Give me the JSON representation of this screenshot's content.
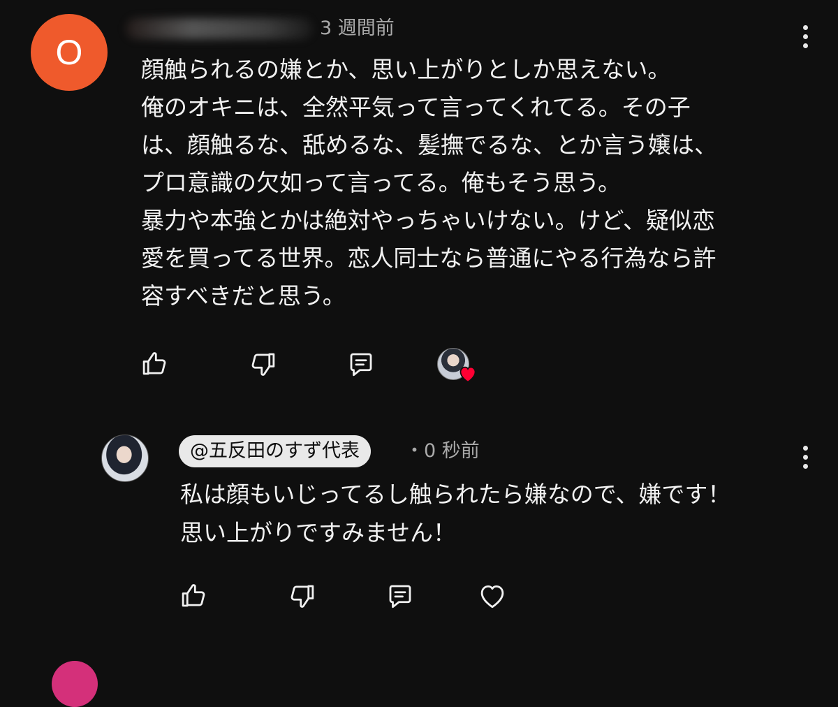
{
  "comment": {
    "avatar_letter": "O",
    "time": "3 週間前",
    "text": "顔触られるの嫌とか、思い上がりとしか思えない。\n俺のオキニは、全然平気って言ってくれてる。その子\nは、顔触るな、舐めるな、髪撫でるな、とか言う嬢は、\nプロ意識の欠如って言ってる。俺もそう思う。\n暴力や本強とかは絶対やっちゃいけない。けど、疑似恋\n愛を買ってる世界。恋人同士なら普通にやる行為なら許\n容すべきだと思う。",
    "actions": [
      "like-icon",
      "dislike-icon",
      "reply-icon"
    ],
    "creator_heart": true
  },
  "reply": {
    "handle": "@五反田のすず代表",
    "separator": "・",
    "time": "0 秒前",
    "text": "私は顔もいじってるし触られたら嫌なので、嫌です！\n思い上がりですみません！",
    "actions": [
      "like-icon",
      "dislike-icon",
      "reply-icon",
      "heart-icon"
    ]
  },
  "colors": {
    "background": "#0f0f0f",
    "avatar_orange": "#ef5a2c",
    "heart_red": "#ff0033",
    "secondary_text": "#aaaaaa"
  }
}
